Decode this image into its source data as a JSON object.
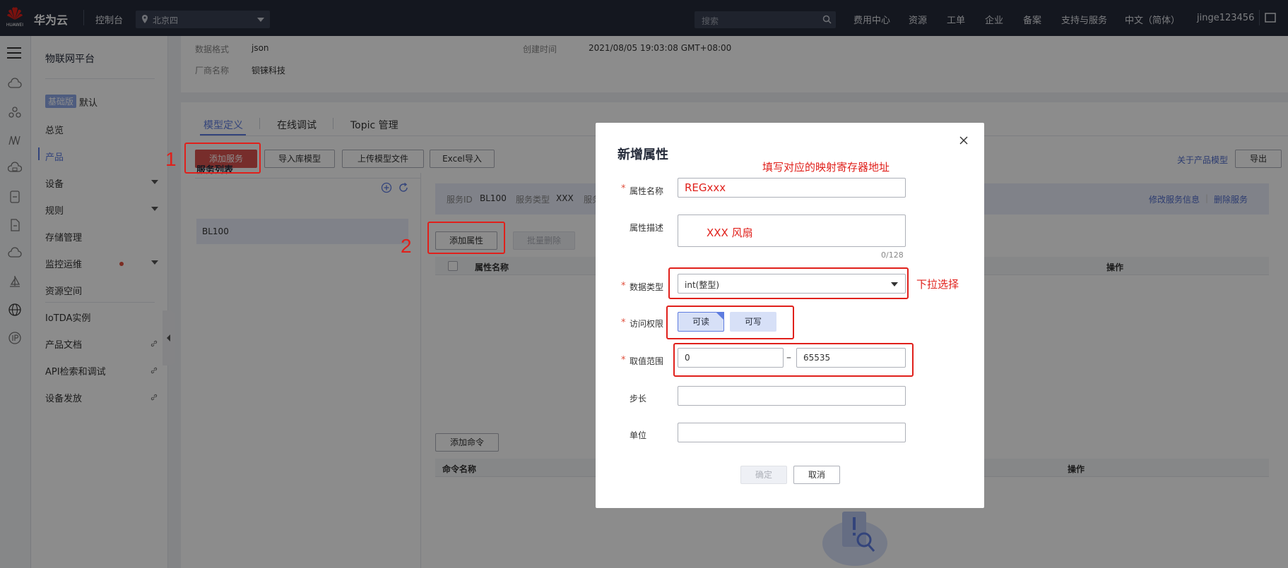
{
  "topbar": {
    "brand": "华为云",
    "logo_text": "HUAWEI",
    "console": "控制台",
    "region": "北京四",
    "search_placeholder": "搜索",
    "nav": [
      "费用中心",
      "资源",
      "工单",
      "企业",
      "备案",
      "支持与服务",
      "中文（简体）",
      "jinge123456"
    ]
  },
  "sidebar": {
    "title": "物联网平台",
    "edition_badge": "基础版",
    "edition_label": "默认",
    "items": [
      "总览",
      "产品",
      "设备",
      "规则",
      "存储管理",
      "监控运维",
      "资源空间",
      "IoTDA实例",
      "产品文档",
      "API检索和调试",
      "设备发放"
    ]
  },
  "detail": {
    "data_format_label": "数据格式",
    "data_format_value": "json",
    "vendor_label": "厂商名称",
    "vendor_value": "钡铼科技",
    "created_label": "创建时间",
    "created_value": "2021/08/05 19:03:08 GMT+08:00"
  },
  "tabs": [
    "模型定义",
    "在线调试",
    "Topic 管理"
  ],
  "toolbar": {
    "add_service": "添加服务",
    "import_lib": "导入库模型",
    "upload_model": "上传模型文件",
    "excel_import": "Excel导入",
    "about_model": "关于产品模型",
    "export": "导出"
  },
  "service_list": {
    "header": "服务列表",
    "rows": [
      "BL100"
    ]
  },
  "service_info": {
    "id_label": "服务ID",
    "id_value": "BL100",
    "type_label": "服务类型",
    "type_value": "XXX",
    "desc_label_partial": "服务",
    "edit": "修改服务信息",
    "delete": "删除服务"
  },
  "properties": {
    "add": "添加属性",
    "batch_delete": "批量删除",
    "col_name": "属性名称",
    "col_ops": "操作"
  },
  "commands": {
    "add": "添加命令",
    "col_name": "命令名称",
    "col_ops": "操作"
  },
  "modal": {
    "title": "新增属性",
    "name_label": "属性名称",
    "name_value": "REGxxx",
    "desc_label": "属性描述",
    "desc_value": "XXX 风扇",
    "desc_counter": "0/128",
    "type_label": "数据类型",
    "type_value": "int(整型)",
    "access_label": "访问权限",
    "access_read": "可读",
    "access_write": "可写",
    "range_label": "取值范围",
    "range_min": "0",
    "range_max": "65535",
    "range_dash": "–",
    "step_label": "步长",
    "unit_label": "单位",
    "confirm": "确定",
    "cancel": "取消",
    "required_mark": "*"
  },
  "annotations": {
    "num1": "1",
    "num2": "2",
    "hint_mapping": "填写对应的映射寄存器地址",
    "hint_dropdown": "下拉选择",
    "color": "#e0201b"
  }
}
